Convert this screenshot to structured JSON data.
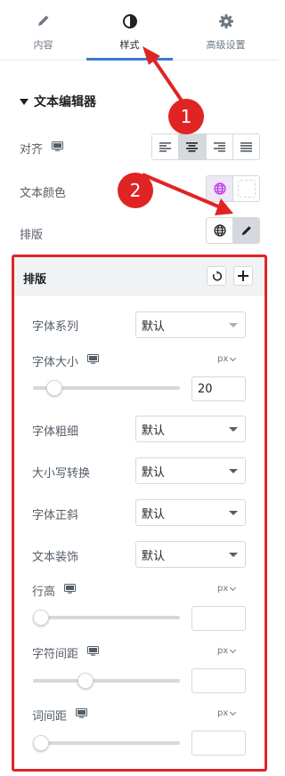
{
  "tabs": [
    {
      "label": "内容",
      "icon": "pencil-icon"
    },
    {
      "label": "样式",
      "icon": "contrast-icon",
      "active": true
    },
    {
      "label": "高级设置",
      "icon": "gear-icon"
    }
  ],
  "section": {
    "title": "文本编辑器"
  },
  "align": {
    "label": "对齐",
    "icon": "desktop-icon",
    "options": [
      "left",
      "center",
      "right",
      "justify"
    ],
    "selected": "center"
  },
  "text_color": {
    "label": "文本颜色",
    "icons": [
      "globe-icon",
      "empty-swatch"
    ]
  },
  "typography": {
    "label": "排版",
    "icons": [
      "globe-icon",
      "pencil-icon"
    ]
  },
  "popover": {
    "title": "排版",
    "reset_icon": "reset-icon",
    "add_icon": "plus-icon",
    "font_family": {
      "label": "字体系列",
      "value": "默认"
    },
    "font_size": {
      "label": "字体大小",
      "unit": "px",
      "value": "20",
      "slider_fraction": 0.1
    },
    "font_weight": {
      "label": "字体粗细",
      "value": "默认"
    },
    "text_transform": {
      "label": "大小写转换",
      "value": "默认"
    },
    "font_style": {
      "label": "字体正斜",
      "value": "默认"
    },
    "text_decoration": {
      "label": "文本装饰",
      "value": "默认"
    },
    "line_height": {
      "label": "行高",
      "unit": "px",
      "value": "",
      "slider_fraction": 0.0
    },
    "letter_spacing": {
      "label": "字符间距",
      "unit": "px",
      "value": "",
      "slider_fraction": 0.34
    },
    "word_spacing": {
      "label": "词间距",
      "unit": "px",
      "value": "",
      "slider_fraction": 0.0
    }
  },
  "annotations": [
    {
      "number": "1"
    },
    {
      "number": "2"
    }
  ],
  "colors": {
    "accent": "#3a7bd5",
    "annotation": "#e02424",
    "globe_accent": "#c036e8"
  }
}
